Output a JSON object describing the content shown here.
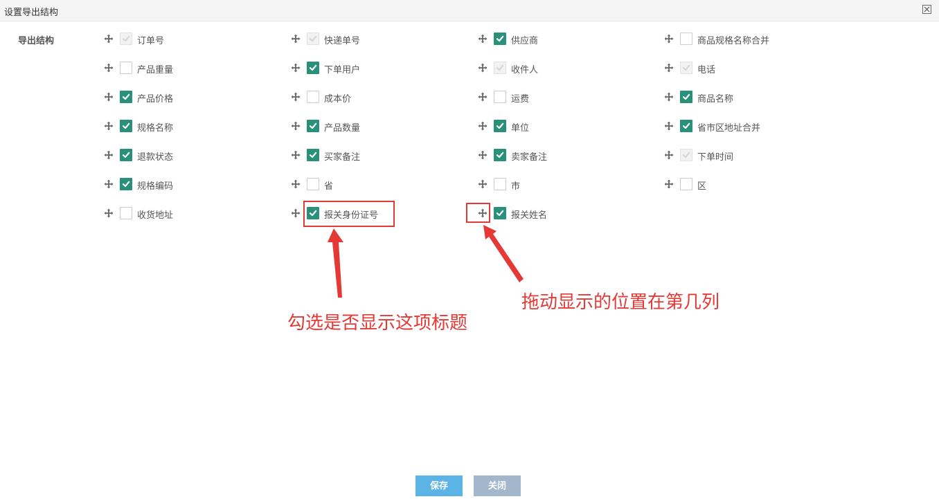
{
  "dialog": {
    "title": "设置导出结构",
    "close_icon": "close-x-icon"
  },
  "section": {
    "label": "导出结构"
  },
  "fields": [
    {
      "label": "订单号",
      "state": "disabled"
    },
    {
      "label": "快递单号",
      "state": "disabled"
    },
    {
      "label": "供应商",
      "state": "checked"
    },
    {
      "label": "商品规格名称合并",
      "state": "unchecked"
    },
    {
      "label": "产品重量",
      "state": "unchecked"
    },
    {
      "label": "下单用户",
      "state": "checked"
    },
    {
      "label": "收件人",
      "state": "disabled"
    },
    {
      "label": "电话",
      "state": "disabled"
    },
    {
      "label": "产品价格",
      "state": "checked"
    },
    {
      "label": "成本价",
      "state": "unchecked"
    },
    {
      "label": "运费",
      "state": "unchecked"
    },
    {
      "label": "商品名称",
      "state": "checked"
    },
    {
      "label": "规格名称",
      "state": "checked"
    },
    {
      "label": "产品数量",
      "state": "checked"
    },
    {
      "label": "单位",
      "state": "checked"
    },
    {
      "label": "省市区地址合并",
      "state": "checked"
    },
    {
      "label": "退款状态",
      "state": "checked"
    },
    {
      "label": "买家备注",
      "state": "checked"
    },
    {
      "label": "卖家备注",
      "state": "checked"
    },
    {
      "label": "下单时间",
      "state": "disabled"
    },
    {
      "label": "规格编码",
      "state": "checked"
    },
    {
      "label": "省",
      "state": "unchecked"
    },
    {
      "label": "市",
      "state": "unchecked"
    },
    {
      "label": "区",
      "state": "unchecked"
    },
    {
      "label": "收货地址",
      "state": "unchecked"
    },
    {
      "label": "报关身份证号",
      "state": "checked"
    },
    {
      "label": "报关姓名",
      "state": "checked"
    }
  ],
  "annotations": {
    "checkbox_note": "勾选是否显示这项标题",
    "drag_note": "拖动显示的位置在第几列",
    "color": "#e53935"
  },
  "buttons": {
    "save_label": "保存",
    "close_label": "关闭"
  },
  "colors": {
    "checked": "#29907a",
    "save_button": "#5cb3e6",
    "close_button": "#a2b7cb"
  }
}
